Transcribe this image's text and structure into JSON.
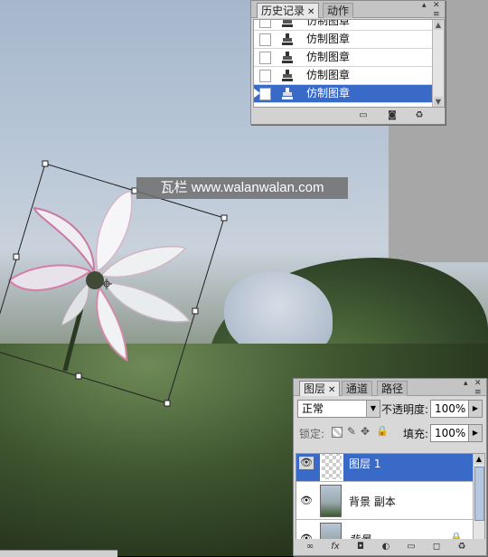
{
  "watermark": "瓦栏 www.walanwalan.com",
  "history": {
    "tabs": [
      {
        "label": "历史记录",
        "closable": true
      },
      {
        "label": "动作"
      }
    ],
    "rows": [
      {
        "label": "仿制图章",
        "selected": false
      },
      {
        "label": "仿制图章",
        "selected": false
      },
      {
        "label": "仿制图章",
        "selected": false
      },
      {
        "label": "仿制图章",
        "selected": false
      },
      {
        "label": "仿制图章",
        "selected": true
      }
    ],
    "bottom_icons": [
      "new-document-icon",
      "snapshot-camera-icon",
      "trash-icon"
    ]
  },
  "layers": {
    "tabs": [
      {
        "label": "图层",
        "closable": true
      },
      {
        "label": "通道"
      },
      {
        "label": "路径"
      }
    ],
    "blend_mode": "正常",
    "opacity_label": "不透明度:",
    "opacity_value": "100%",
    "lock_label": "锁定:",
    "fill_label": "填充:",
    "fill_value": "100%",
    "rows": [
      {
        "name": "图层 1",
        "selected": true,
        "thumb": "transparent"
      },
      {
        "name": "背景 副本",
        "selected": false,
        "thumb": "photo"
      },
      {
        "name": "背景",
        "selected": false,
        "thumb": "photo",
        "locked": true
      }
    ],
    "bottom_icons": [
      "link-icon",
      "fx-icon",
      "mask-icon",
      "adjustment-icon",
      "group-folder-icon",
      "new-layer-icon",
      "trash-icon"
    ]
  }
}
